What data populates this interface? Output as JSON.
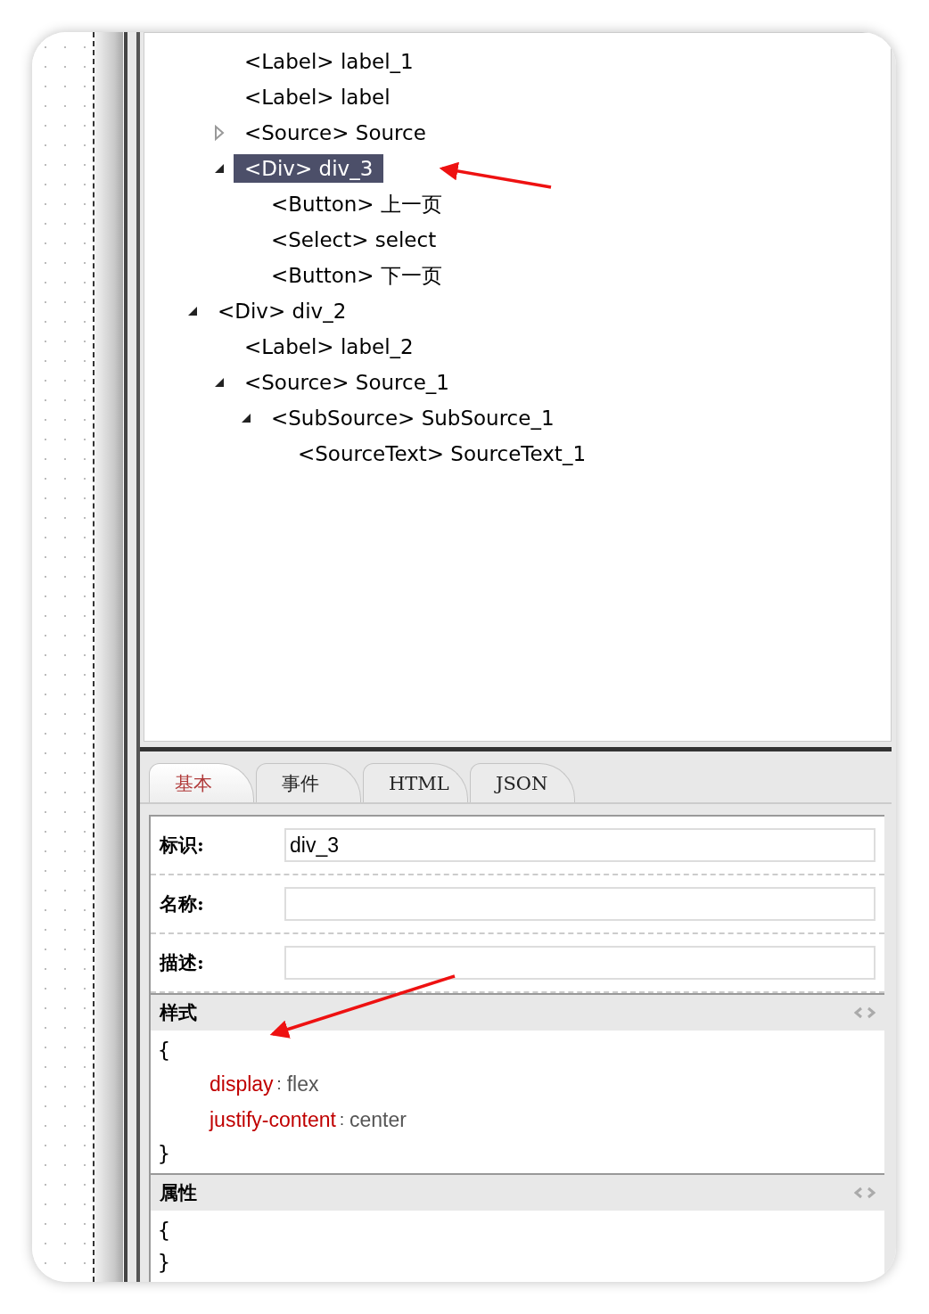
{
  "tree": {
    "items": [
      {
        "children": [
          {
            "label": "<Label> label_1",
            "selected": false
          },
          {
            "label": "<Label> label",
            "selected": false
          },
          {
            "label": "<Source> Source",
            "expanded": false,
            "selected": false
          },
          {
            "label": "<Div> div_3",
            "expanded": true,
            "selected": true,
            "children": [
              {
                "label": "<Button> 上一页",
                "selected": false
              },
              {
                "label": "<Select> select",
                "selected": false
              },
              {
                "label": "<Button> 下一页",
                "selected": false
              }
            ]
          }
        ]
      },
      {
        "label": "<Div> div_2",
        "expanded": true,
        "selected": false,
        "children": [
          {
            "label": "<Label> label_2",
            "selected": false
          },
          {
            "label": "<Source> Source_1",
            "expanded": true,
            "selected": false,
            "children": [
              {
                "label": "<SubSource> SubSource_1",
                "expanded": true,
                "selected": false,
                "children": [
                  {
                    "label": "<SourceText> SourceText_1",
                    "selected": false
                  }
                ]
              }
            ]
          }
        ]
      }
    ]
  },
  "tabs": [
    {
      "label": "基本",
      "selected": true
    },
    {
      "label": "事件",
      "selected": false
    },
    {
      "label": "HTML",
      "selected": false
    },
    {
      "label": "JSON",
      "selected": false
    }
  ],
  "fields": [
    {
      "label": "标识:",
      "value": "div_3"
    },
    {
      "label": "名称:"
    },
    {
      "label": "描述:"
    }
  ],
  "sections": [
    {
      "title": "样式",
      "open_brace": "{",
      "properties": [
        {
          "name": "display",
          "colon": ":",
          "value": "flex"
        },
        {
          "name": "justify-content",
          "colon": ":",
          "value": "center"
        }
      ],
      "close_brace": "}"
    },
    {
      "title": "属性",
      "open_brace": "{",
      "close_brace": "}"
    }
  ]
}
